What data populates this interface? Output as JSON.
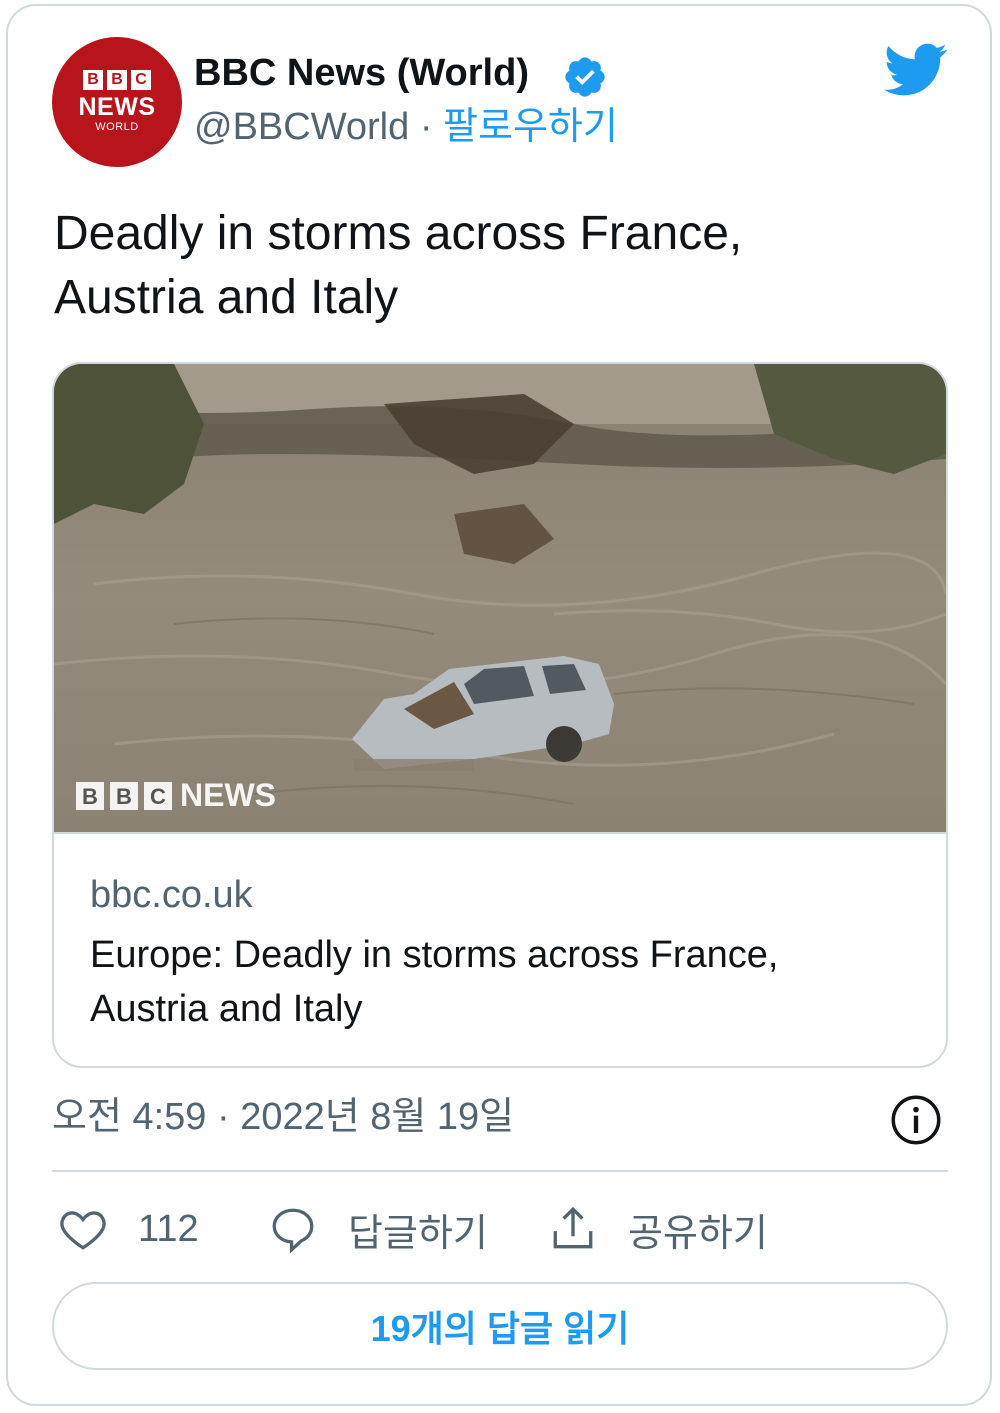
{
  "tweet": {
    "author": {
      "avatar": {
        "bbc_letters": [
          "B",
          "B",
          "C"
        ],
        "news": "NEWS",
        "world": "WORLD"
      },
      "display_name": "BBC News (World)",
      "verified": true,
      "handle": "@BBCWorld",
      "separator": "·",
      "follow_label": "팔로우하기"
    },
    "text_line1": "Deadly in storms across France,",
    "text_line2": "Austria and Italy",
    "link_card": {
      "image_watermark": {
        "letters": [
          "B",
          "B",
          "C"
        ],
        "news": "NEWS"
      },
      "domain": "bbc.co.uk",
      "title_line1": "Europe: Deadly in storms across France,",
      "title_line2": "Austria and Italy"
    },
    "timestamp": "오전 4:59 · 2022년 8월 19일",
    "actions": {
      "like_count": "112",
      "reply_label": "답글하기",
      "share_label": "공유하기"
    },
    "read_replies_label": "19개의 답글 읽기"
  },
  "colors": {
    "accent": "#1d9bf0",
    "bbc_red": "#b8141c",
    "secondary_text": "#536471",
    "border": "#cfd9de"
  },
  "icons": [
    "twitter-bird-icon",
    "verified-badge-icon",
    "info-icon",
    "heart-icon",
    "reply-bubble-icon",
    "share-icon"
  ]
}
